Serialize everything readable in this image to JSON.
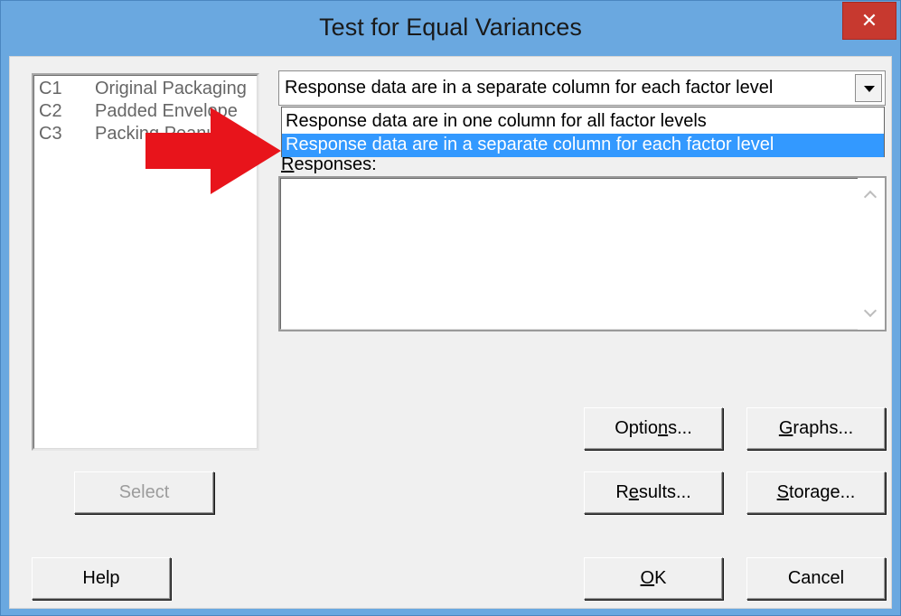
{
  "window": {
    "title": "Test for Equal Variances",
    "close_label": "✕"
  },
  "variables": [
    {
      "id": "C1",
      "name": "Original Packaging"
    },
    {
      "id": "C2",
      "name": "Padded Envelope"
    },
    {
      "id": "C3",
      "name": "Packing Peanuts"
    }
  ],
  "layout_select": {
    "value": "Response data are in a separate column for each factor level",
    "options": [
      "Response data are in one column for all factor levels",
      "Response data are in a separate column for each factor level"
    ],
    "selected_index": 1
  },
  "responses": {
    "label_accel": "R",
    "label_rest": "esponses:",
    "value": ""
  },
  "buttons": {
    "select": "Select",
    "options_pre": "Optio",
    "options_accel": "n",
    "options_post": "s...",
    "graphs_pre": "",
    "graphs_accel": "G",
    "graphs_post": "raphs...",
    "results_pre": "R",
    "results_accel": "e",
    "results_post": "sults...",
    "storage_pre": "",
    "storage_accel": "S",
    "storage_post": "torage...",
    "help": "Help",
    "ok_accel": "O",
    "ok_post": "K",
    "cancel": "Cancel"
  },
  "colors": {
    "title_bar": "#6aa8e0",
    "close_button": "#c7392f",
    "selection": "#3399ff",
    "annotation_arrow": "#e8141b"
  }
}
